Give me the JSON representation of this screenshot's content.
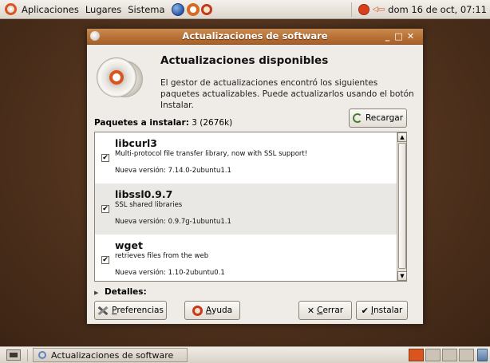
{
  "top_panel": {
    "menus": [
      "Aplicaciones",
      "Lugares",
      "Sistema"
    ],
    "clock": "dom 16 de oct, 07:11"
  },
  "window": {
    "title": "Actualizaciones de software",
    "heading": "Actualizaciones disponibles",
    "description": "El gestor de actualizaciones encontró los siguientes paquetes actualizables. Puede actualizarlos usando el botón Instalar.",
    "packages_label": "Paquetes a instalar:",
    "packages_count": "3 (2676k)",
    "reload_label": "Recargar",
    "details_label": "Detalles:",
    "packages": [
      {
        "name": "libcurl3",
        "description": "Multi-protocol file transfer library, now with SSL support!",
        "version": "Nueva versión: 7.14.0-2ubuntu1.1",
        "checked": true
      },
      {
        "name": "libssl0.9.7",
        "description": "SSL shared libraries",
        "version": "Nueva versión: 0.9.7g-1ubuntu1.1",
        "checked": true
      },
      {
        "name": "wget",
        "description": "retrieves files from the web",
        "version": "Nueva versión: 1.10-2ubuntu0.1",
        "checked": true
      }
    ],
    "buttons": {
      "preferences": {
        "prefix": "",
        "mnemonic": "P",
        "rest": "referencias"
      },
      "help": {
        "prefix": "",
        "mnemonic": "A",
        "rest": "yuda"
      },
      "close": {
        "prefix": "",
        "mnemonic": "C",
        "rest": "errar"
      },
      "install": {
        "prefix": "",
        "mnemonic": "I",
        "rest": "nstalar"
      }
    }
  },
  "bottom_panel": {
    "task_label": "Actualizaciones de software"
  },
  "colors": {
    "desktop": "#4d301c",
    "titlebar": "#b86e33",
    "accent": "#d9541e"
  }
}
